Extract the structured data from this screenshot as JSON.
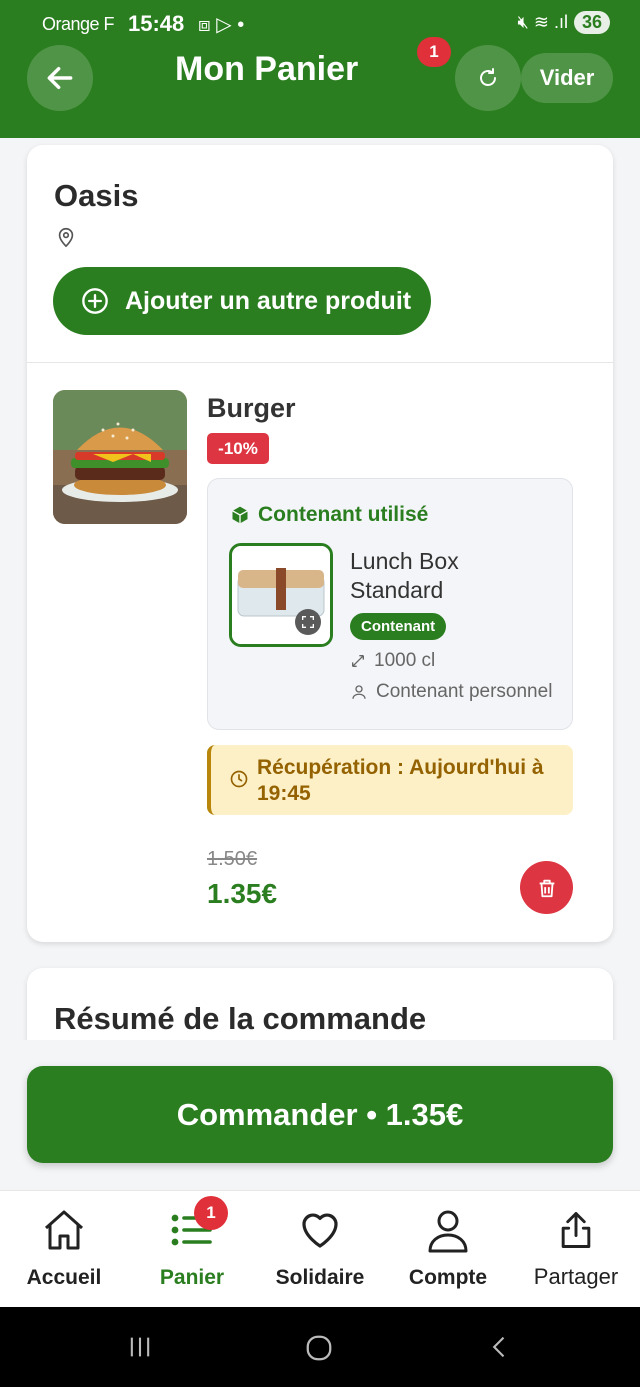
{
  "status_bar": {
    "carrier": "Orange F",
    "time": "15:48",
    "battery": "36"
  },
  "header": {
    "title": "Mon Panier",
    "badge_count": "1",
    "clear_label": "Vider"
  },
  "shop": {
    "name": "Oasis",
    "add_product_label": "Ajouter un autre produit"
  },
  "item": {
    "name": "Burger",
    "discount": "-10%",
    "container": {
      "heading": "Contenant utilisé",
      "name": "Lunch Box Standard",
      "tag": "Contenant",
      "volume": "1000 cl",
      "owner": "Contenant personnel"
    },
    "pickup": "Récupération : Aujourd'hui à 19:45",
    "old_price": "1.50€",
    "new_price": "1.35€"
  },
  "summary": {
    "title": "Résumé de la commande"
  },
  "cta": {
    "label": "Commander • 1.35€"
  },
  "nav": {
    "items": [
      {
        "label": "Accueil",
        "icon": "home-icon"
      },
      {
        "label": "Panier",
        "icon": "list-icon",
        "badge": "1"
      },
      {
        "label": "Solidaire",
        "icon": "heart-icon"
      },
      {
        "label": "Compte",
        "icon": "user-icon"
      },
      {
        "label": "Partager",
        "icon": "share-icon"
      }
    ]
  },
  "colors": {
    "brand_green": "#2a7e1f",
    "danger_red": "#dd3642",
    "pickup_bg": "#fdf0c6"
  }
}
